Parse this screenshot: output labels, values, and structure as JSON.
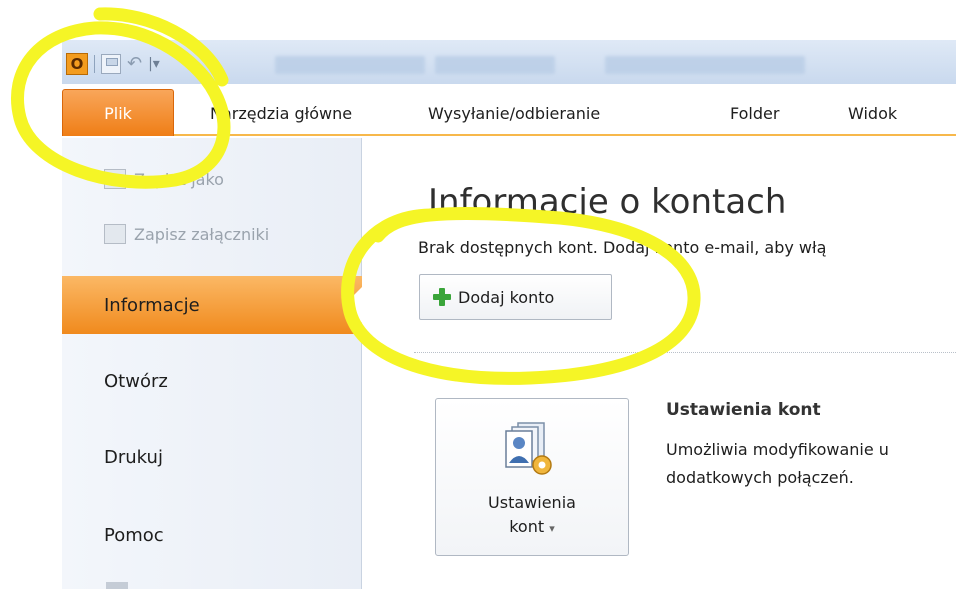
{
  "quick_access": {
    "app_icon_letter": "O",
    "save_icon": "save-icon",
    "undo_icon": "undo-icon",
    "customize_icon": "customize-qat-icon"
  },
  "ribbon": {
    "file_tab": "Plik",
    "tabs": [
      "Narzędzia główne",
      "Wysyłanie/odbieranie",
      "Folder",
      "Widok"
    ]
  },
  "backstage_nav": {
    "commands": [
      "Zapisz jako",
      "Zapisz załączniki"
    ],
    "items": [
      "Informacje",
      "Otwórz",
      "Drukuj",
      "Pomoc"
    ],
    "active_item": "Informacje"
  },
  "main": {
    "title": "Informacje o kontach",
    "subtitle": "Brak dostępnych kont. Dodaj konto e-mail, aby włą",
    "add_account_button": "Dodaj konto",
    "account_settings_button": {
      "line1": "Ustawienia",
      "line2": "kont",
      "dropdown": "▾"
    },
    "account_settings_heading": "Ustawienia kont",
    "account_settings_desc": [
      "Umożliwia modyfikowanie u",
      "dodatkowych połączeń."
    ]
  },
  "colors": {
    "accent_orange": "#f08a1d",
    "highlight_marker": "#f5f526",
    "ribbon_underline": "#f7b84b"
  }
}
